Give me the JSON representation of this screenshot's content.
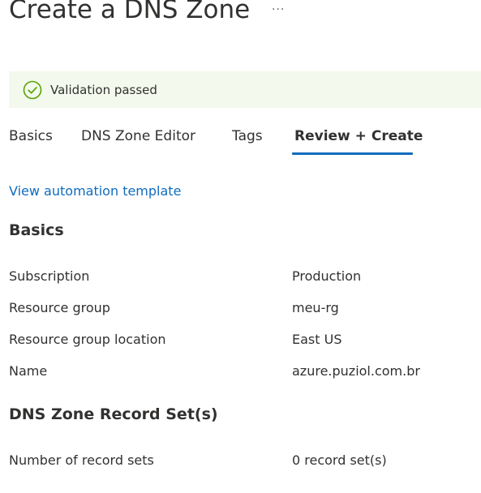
{
  "header": {
    "title": "Create a DNS Zone",
    "more_label": "···"
  },
  "banner": {
    "message": "Validation passed",
    "icon": "check-circle-icon",
    "icon_color": "#57a300",
    "background": "#f3f9ec"
  },
  "tabs": [
    {
      "label": "Basics",
      "active": false
    },
    {
      "label": "DNS Zone Editor",
      "active": false
    },
    {
      "label": "Tags",
      "active": false
    },
    {
      "label": "Review + Create",
      "active": true
    }
  ],
  "accent_color": "#0f6cbd",
  "automation_link": "View automation template",
  "sections": {
    "basics": {
      "title": "Basics",
      "rows": [
        {
          "label": "Subscription",
          "value": "Production"
        },
        {
          "label": "Resource group",
          "value": "meu-rg"
        },
        {
          "label": "Resource group location",
          "value": "East US"
        },
        {
          "label": "Name",
          "value": "azure.puziol.com.br"
        }
      ]
    },
    "record_sets": {
      "title": "DNS Zone Record Set(s)",
      "rows": [
        {
          "label": "Number of record sets",
          "value": "0 record set(s)"
        }
      ]
    }
  }
}
